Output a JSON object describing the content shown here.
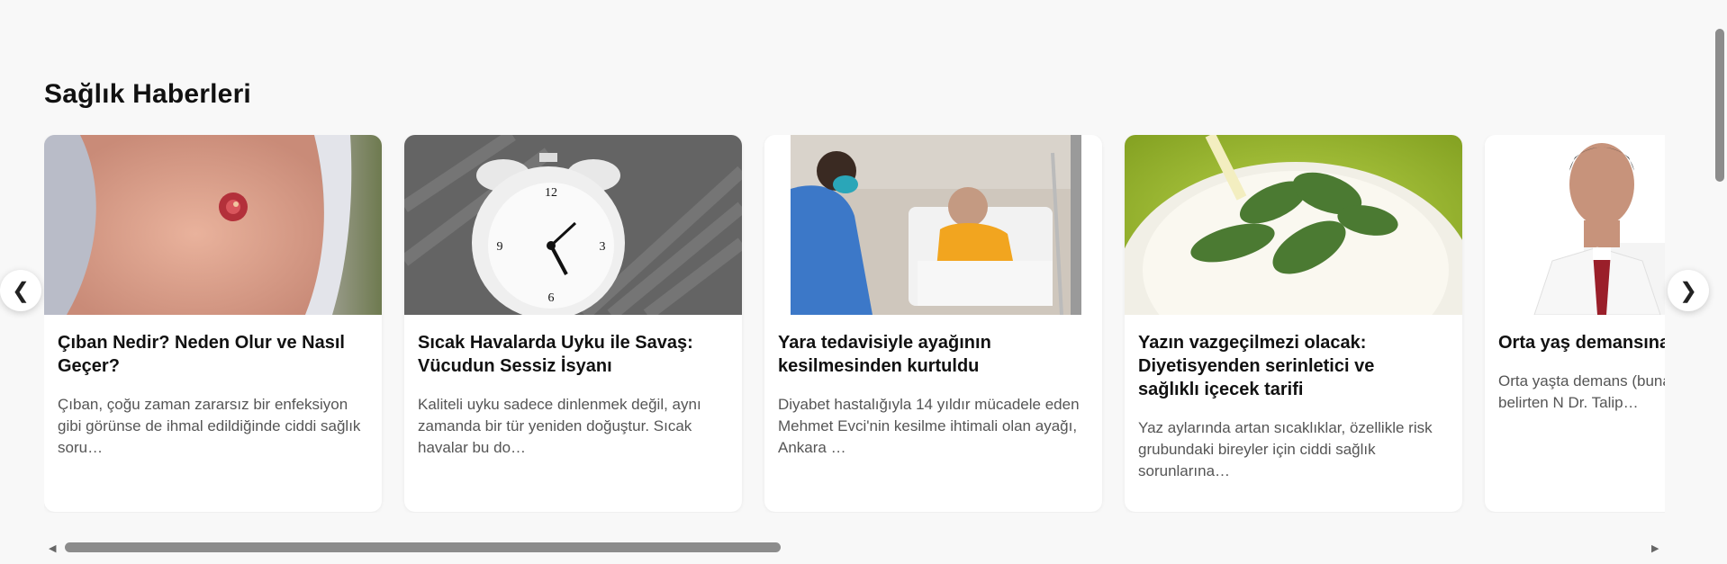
{
  "section": {
    "title": "Sağlık Haberleri"
  },
  "nav": {
    "prev_icon": "‹",
    "next_icon": "›",
    "prev_glyph": "❮",
    "next_glyph": "❯"
  },
  "cards": [
    {
      "title": "Çıban Nedir? Neden Olur ve Nasıl Geçer?",
      "description": "Çıban, çoğu zaman zararsız bir enfeksiyon gibi görünse de ihmal edildiğinde ciddi sağlık soru…",
      "image": "arm-boil-photo"
    },
    {
      "title": "Sıcak Havalarda Uyku ile Savaş: Vücudun Sessiz İsyanı",
      "description": "Kaliteli uyku sadece dinlenmek değil, aynı zamanda bir tür yeniden doğuştur. Sıcak havalar bu do…",
      "image": "alarm-clock-photo"
    },
    {
      "title": "Yara tedavisiyle ayağının kesilmesinden kurtuldu",
      "description": "Diyabet hastalığıyla 14 yıldır mücadele eden Mehmet Evci'nin kesilme ihtimali olan ayağı, Ankara …",
      "image": "hospital-patient-photo"
    },
    {
      "title": "Yazın vazgeçilmezi olacak: Diyetisyenden serinletici ve sağlıklı içecek tarifi",
      "description": "Yaz aylarında artan sıcaklıklar, özellikle risk grubundaki bireyler için ciddi sağlık sorunlarına…",
      "image": "mint-drink-photo"
    },
    {
      "title": "Orta yaş demansına",
      "description": "Orta yaşta demans (buna riskinin arttığını belirten N Dr. Talip…",
      "image": "doctor-portrait-photo"
    }
  ],
  "colors": {
    "background": "#f8f8f8",
    "card": "#ffffff",
    "scrollbar": "#8c8c8c"
  }
}
